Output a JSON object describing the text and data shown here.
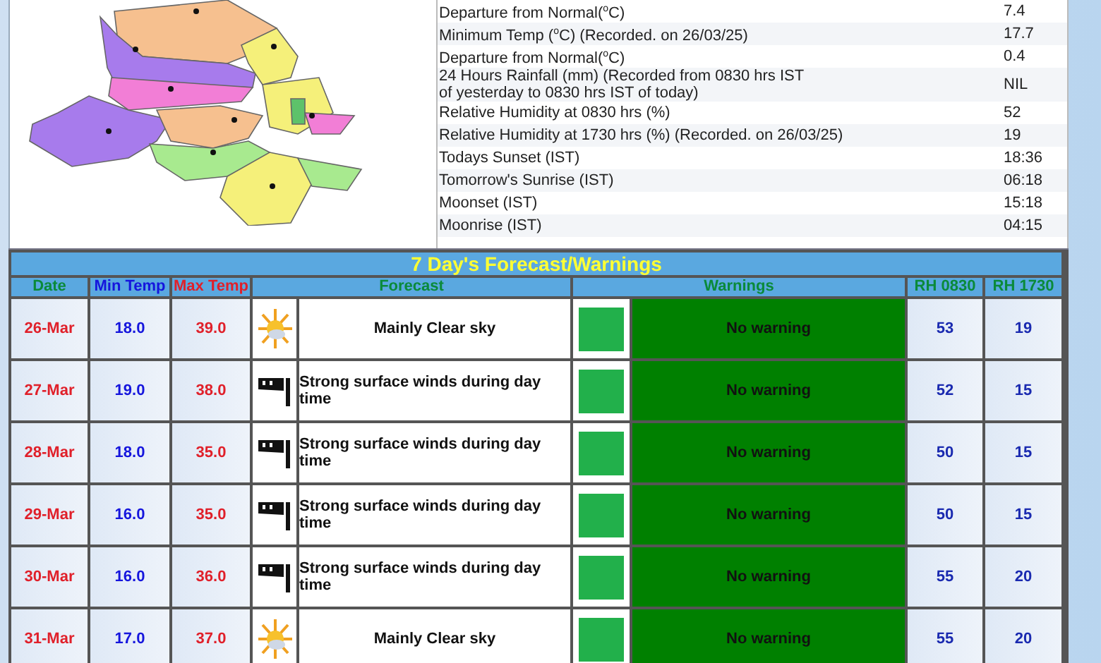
{
  "observations": [
    {
      "label": "Departure from Normal($^{o}$C)",
      "value": "7.4"
    },
    {
      "label": "Minimum Temp ($^{o}$C) (Recorded. on 26/03/25)",
      "value": "17.7"
    },
    {
      "label": "Departure from Normal($^{o}$C)",
      "value": "0.4"
    },
    {
      "label": "24 Hours Rainfall (mm) (Recorded from 0830 hrs IST\nof yesterday to 0830 hrs IST of today)",
      "value": "NIL"
    },
    {
      "label": "Relative Humidity at 0830 hrs (%)",
      "value": "52"
    },
    {
      "label": "Relative Humidity at 1730 hrs (%) (Recorded. on 26/03/25)",
      "value": "19"
    },
    {
      "label": "Todays Sunset (IST)",
      "value": "18:36"
    },
    {
      "label": "Tomorrow's Sunrise (IST)",
      "value": "06:18"
    },
    {
      "label": "Moonset (IST)",
      "value": "15:18"
    },
    {
      "label": "Moonrise (IST)",
      "value": "04:15"
    }
  ],
  "forecast": {
    "title": "7 Day's Forecast/Warnings",
    "columns": [
      "Date",
      "Min Temp",
      "Max Temp",
      "Forecast",
      "Warnings",
      "RH 0830",
      "RH 1730"
    ],
    "rows": [
      {
        "date": "26-Mar",
        "min": "18.0",
        "max": "39.0",
        "kind": "clear",
        "forecast": "Mainly Clear sky",
        "warning": "No warning",
        "color": "#22b04b",
        "rh0830": "53",
        "rh1730": "19"
      },
      {
        "date": "27-Mar",
        "min": "19.0",
        "max": "38.0",
        "kind": "wind",
        "forecast": "Strong surface winds during day time",
        "warning": "No warning",
        "color": "#22b04b",
        "rh0830": "52",
        "rh1730": "15"
      },
      {
        "date": "28-Mar",
        "min": "18.0",
        "max": "35.0",
        "kind": "wind",
        "forecast": "Strong surface winds during day time",
        "warning": "No warning",
        "color": "#22b04b",
        "rh0830": "50",
        "rh1730": "15"
      },
      {
        "date": "29-Mar",
        "min": "16.0",
        "max": "35.0",
        "kind": "wind",
        "forecast": "Strong surface winds during day time",
        "warning": "No warning",
        "color": "#22b04b",
        "rh0830": "50",
        "rh1730": "15"
      },
      {
        "date": "30-Mar",
        "min": "16.0",
        "max": "36.0",
        "kind": "wind",
        "forecast": "Strong surface winds during day time",
        "warning": "No warning",
        "color": "#22b04b",
        "rh0830": "55",
        "rh1730": "20"
      },
      {
        "date": "31-Mar",
        "min": "17.0",
        "max": "37.0",
        "kind": "clear",
        "forecast": "Mainly Clear sky",
        "warning": "No warning",
        "color": "#22b04b",
        "rh0830": "55",
        "rh1730": "20"
      }
    ]
  }
}
